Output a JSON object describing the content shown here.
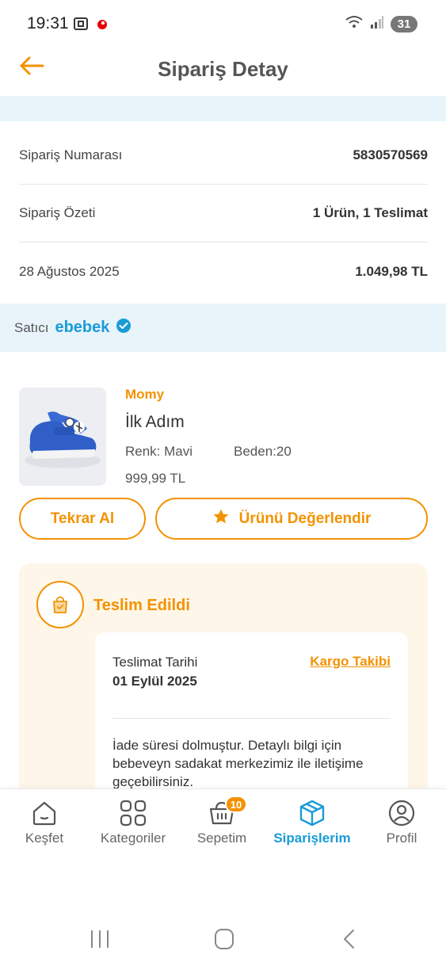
{
  "status_bar": {
    "time": "19:31",
    "battery": "31"
  },
  "header": {
    "title": "Sipariş Detay"
  },
  "summary": [
    {
      "label": "Sipariş Numarası",
      "value": "5830570569"
    },
    {
      "label": "Sipariş Özeti",
      "value": "1 Ürün, 1 Teslimat"
    },
    {
      "label": "28 Ağustos 2025",
      "value": "1.049,98 TL"
    }
  ],
  "seller": {
    "label": "Satıcı",
    "name": "ebebek"
  },
  "product": {
    "brand": "Momy",
    "name": "İlk Adım",
    "color": "Renk: Mavi",
    "size": "Beden:20",
    "price": "999,99 TL"
  },
  "actions": {
    "reorder": "Tekrar Al",
    "review": "Ürünü Değerlendir"
  },
  "delivery": {
    "status": "Teslim Edildi",
    "date_label": "Teslimat Tarihi",
    "date": "01 Eylül 2025",
    "tracking": "Kargo Takibi",
    "note": "İade süresi dolmuştur. Detaylı bilgi için bebeveyn sadakat merkezimiz ile iletişime geçebilirsiniz."
  },
  "nav": {
    "items": [
      {
        "label": "Keşfet"
      },
      {
        "label": "Kategoriler"
      },
      {
        "label": "Sepetim",
        "badge": "10"
      },
      {
        "label": "Siparişlerim"
      },
      {
        "label": "Profil"
      }
    ],
    "active": "Siparişlerim"
  },
  "colors": {
    "accent": "#f39200",
    "brand_blue": "#1a9bd7",
    "strip_bg": "#e8f4fa",
    "card_bg": "#fef6e8"
  }
}
